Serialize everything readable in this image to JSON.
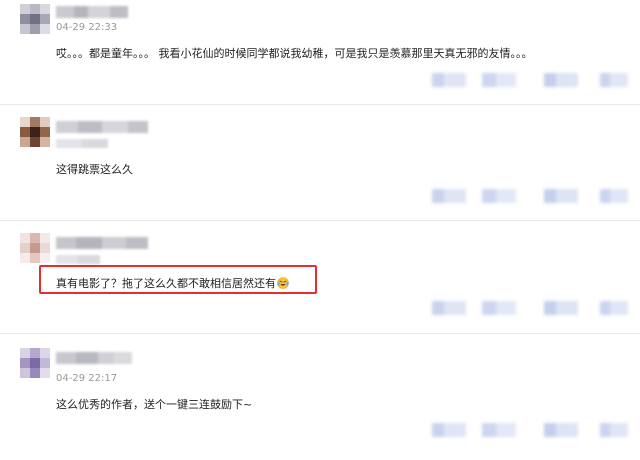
{
  "comments": [
    {
      "time": "04-29 22:33",
      "text": "哎。。。都是童年。。。 我看小花仙的时候同学都说我幼稚，可是我只是羡慕那里天真无邪的友情。。。"
    },
    {
      "time": "",
      "text": "这得跳票这么久"
    },
    {
      "time": "",
      "text": "真有电影了？拖了这么久都不敢相信居然还有"
    },
    {
      "time": "04-29 22:17",
      "text": "这么优秀的作者，送个一键三连鼓励下~"
    }
  ],
  "icons": {
    "reply_emoji": "laughing-tears-emoji-icon",
    "avatar": "pixelated-avatar-icon"
  },
  "colors": {
    "highlight_border": "#e03030",
    "divider": "#e9e9e9",
    "meta_text": "#999999",
    "blur_action": "#c8d2ec"
  }
}
